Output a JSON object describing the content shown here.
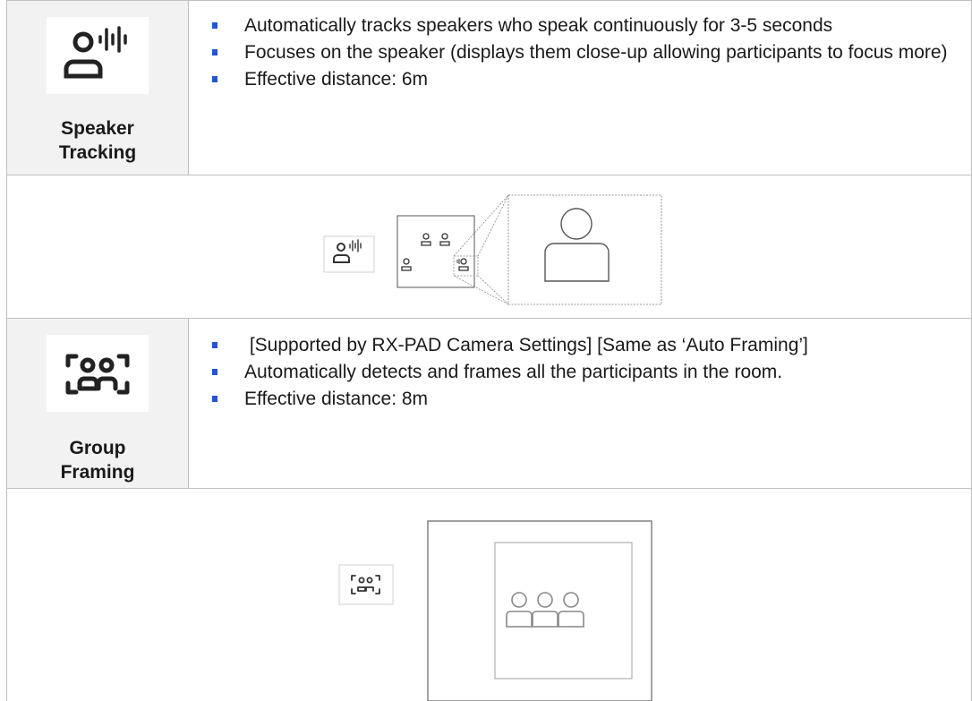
{
  "speaker_tracking": {
    "title_line1": "Speaker",
    "title_line2": "Tracking",
    "icon": "speaker-voice-icon",
    "bullets": [
      "Automatically tracks speakers who speak continuously for 3-5 seconds",
      "Focuses on the speaker (displays them close-up allowing participants to focus more)",
      "Effective distance: 6m"
    ]
  },
  "group_framing": {
    "title_line1": "Group",
    "title_line2": "Framing",
    "icon": "group-frame-icon",
    "bullets": [
      " [Supported by RX-PAD Camera Settings] [Same as ‘Auto Framing’]",
      "Automatically detects and frames all the participants in the room.",
      "Effective distance: 8m"
    ]
  },
  "colors": {
    "bullet": "#1f55d6",
    "label_bg": "#f2f2f2",
    "border": "#bfbfbf"
  }
}
